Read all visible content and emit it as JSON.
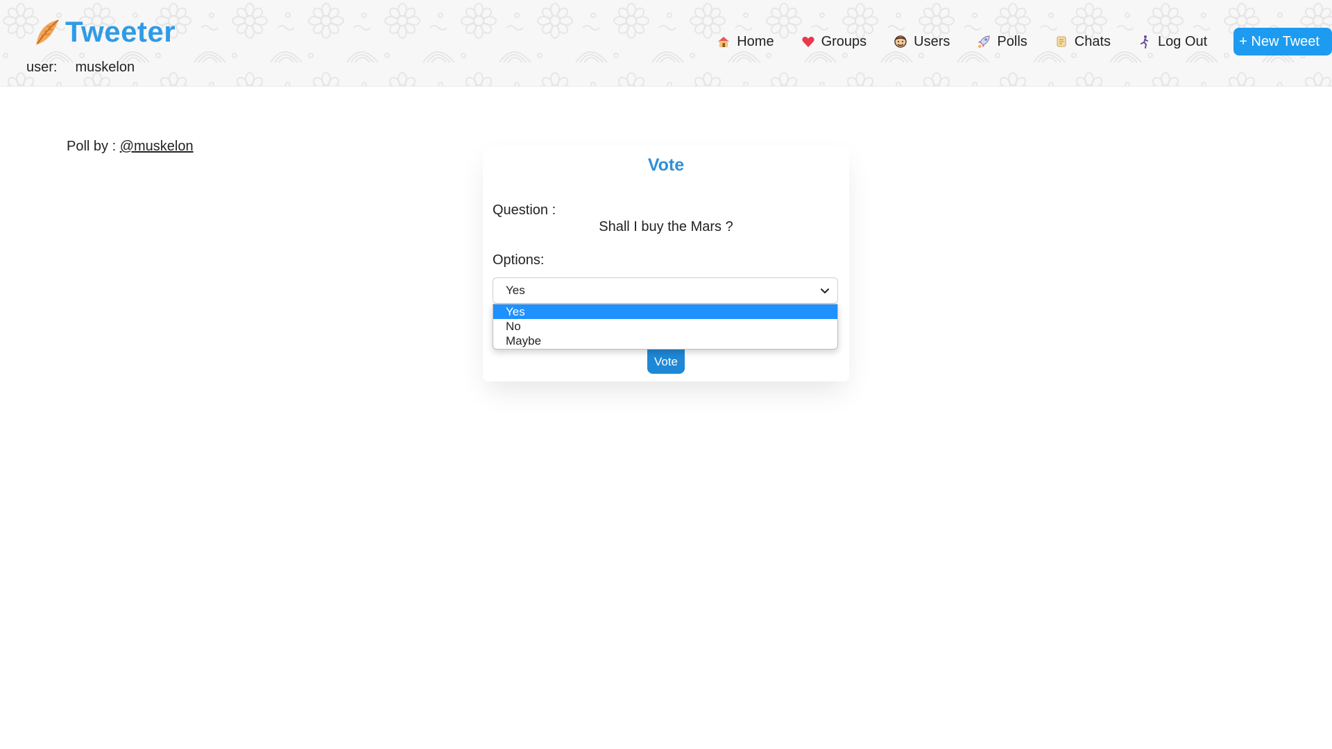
{
  "header": {
    "brand": "Tweeter",
    "user_label": "user:",
    "username": "muskelon",
    "nav": [
      {
        "label": "Home",
        "icon": "house-icon"
      },
      {
        "label": "Groups",
        "icon": "heart-icon"
      },
      {
        "label": "Users",
        "icon": "face-icon"
      },
      {
        "label": "Polls",
        "icon": "rocket-icon"
      },
      {
        "label": "Chats",
        "icon": "scroll-icon"
      },
      {
        "label": "Log Out",
        "icon": "runner-icon"
      }
    ],
    "new_tweet_label": "+ New Tweet"
  },
  "poll": {
    "by_label": "Poll by :",
    "author": "@muskelon",
    "title": "Vote",
    "question_label": "Question :",
    "question": "Shall I buy the Mars ?",
    "options_label": "Options:",
    "selected": "Yes",
    "options": [
      "Yes",
      "No",
      "Maybe"
    ],
    "vote_button": "Vote"
  },
  "colors": {
    "brand": "#2f9be6",
    "accent": "#1d9bf0",
    "highlight": "#1e90ff"
  }
}
